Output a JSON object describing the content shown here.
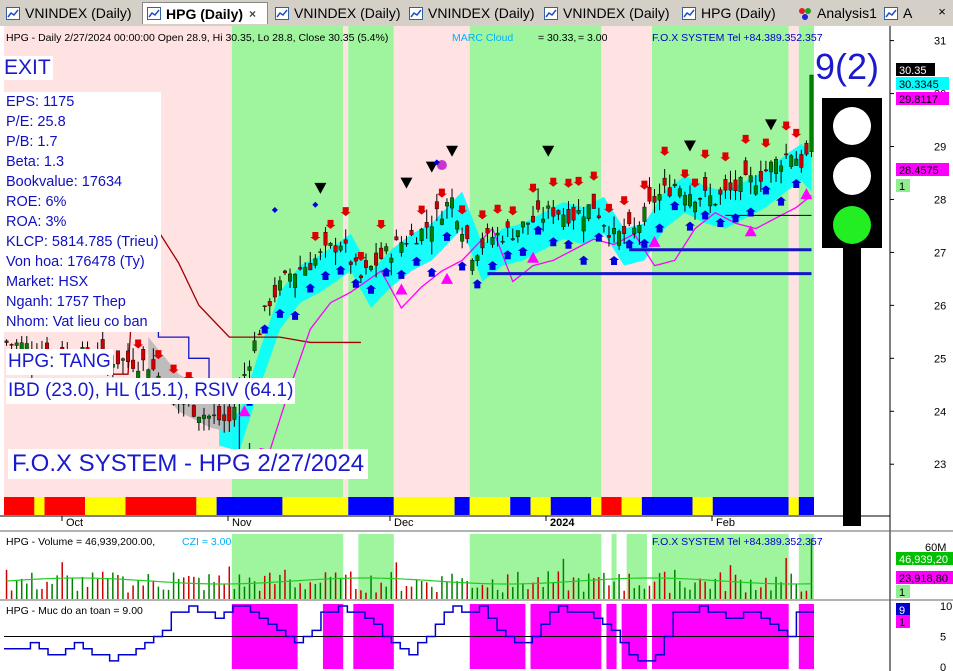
{
  "tabs": [
    {
      "label": "VNINDEX (Daily)",
      "active": false
    },
    {
      "label": "HPG (Daily)",
      "active": true
    },
    {
      "label": "VNINDEX (Daily)",
      "active": false
    },
    {
      "label": "VNINDEX (Daily)",
      "active": false
    },
    {
      "label": "VNINDEX (Daily)",
      "active": false
    },
    {
      "label": "HPG (Daily)",
      "active": false
    },
    {
      "label": "Analysis1",
      "active": false
    },
    {
      "label": "A",
      "active": false
    }
  ],
  "tab_close": "×",
  "price_pane": {
    "header": {
      "title": "HPG - Daily 2/27/2024 00:00:00 Open 28.9, Hi 30.35, Lo 28.8, Close 30.35 (5.4%)",
      "marc_label": "MARC Cloud",
      "marc_value": "= 30.33,",
      "marc_value2": "= 3.00",
      "system": "F.O.X SYSTEM Tel +84.389.352.357"
    },
    "exit_label": "EXIT",
    "fundamentals": [
      "EPS: 1175",
      "P/E: 25.8",
      "P/B: 1.7",
      "Beta: 1.3",
      "Bookvalue: 17634",
      "ROE: 6%",
      "ROA: 3%",
      "KLCP: 5814.785 (Trieu)",
      "Von hoa: 176478 (Ty)",
      "Market: HSX",
      "Nganh: 1757 Thep",
      "Nhom: Vat lieu co ban"
    ],
    "trend": "HPG: TANG",
    "ratings": "IBD (23.0), HL (15.1), RSIV (64.1)",
    "banner": "F.O.X SYSTEM - HPG 2/27/2024",
    "signal_count": "9(2)",
    "y_ticks": [
      "31",
      "30",
      "29",
      "28",
      "27",
      "26",
      "25",
      "24",
      "23"
    ],
    "price_labels": [
      {
        "text": "30.35",
        "bg": "#000000",
        "fg": "#ffffff"
      },
      {
        "text": "30.3345",
        "bg": "#00ffff",
        "fg": "#000000"
      },
      {
        "text": "29.8117",
        "bg": "#ff00ff",
        "fg": "#000000"
      },
      {
        "text": "28.4575",
        "bg": "#ff00ff",
        "fg": "#000000"
      },
      {
        "text": "1",
        "bg": "#90ee90",
        "fg": "#000000"
      }
    ],
    "x_ticks": [
      "Oct",
      "Nov",
      "Dec",
      "2024",
      "Feb"
    ]
  },
  "volume_pane": {
    "header_title": "HPG - Volume = 46,939,200.00,",
    "header_czi": "CZI = 3.00",
    "system": "F.O.X SYSTEM Tel +84.389.352.357",
    "y_tick": "60M",
    "labels": [
      {
        "text": "46,939,20",
        "bg": "#00c000",
        "fg": "#ffffff"
      },
      {
        "text": "23,918,80",
        "bg": "#ff00ff",
        "fg": "#000000"
      },
      {
        "text": "1",
        "bg": "#90ee90",
        "fg": "#000000"
      }
    ]
  },
  "safety_pane": {
    "header": "HPG - Muc do an toan = 9.00",
    "y_ticks": [
      "10",
      "5",
      "0"
    ],
    "labels": [
      {
        "text": "9",
        "bg": "#0000cc",
        "fg": "#ffffff"
      },
      {
        "text": "1",
        "bg": "#ff00ff",
        "fg": "#000000"
      }
    ]
  },
  "colors": {
    "bull_zone": "#9ef59e",
    "bear_zone": "#ffe2e2",
    "cloud": "#00ffff",
    "up_candle": "#008000",
    "down_candle": "#cc0000",
    "magenta": "#ff00ff",
    "blue_line": "#1515c8",
    "traffic_green": "#22ee22"
  }
}
